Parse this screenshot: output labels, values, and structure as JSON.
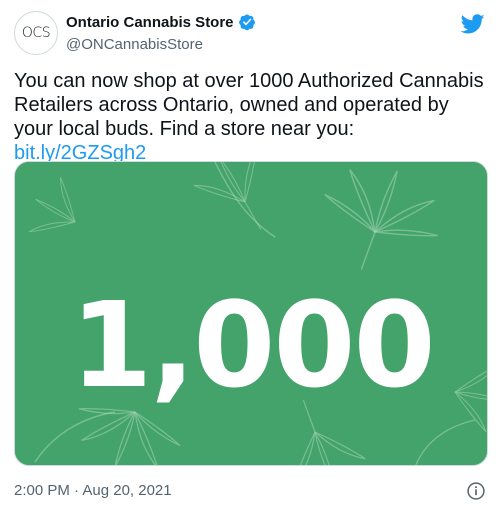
{
  "author": {
    "avatar_text": "OCS",
    "display_name": "Ontario Cannabis Store",
    "handle": "@ONCannabisStore",
    "verified": true
  },
  "tweet": {
    "text": "You can now shop at over 1000 Authorized Cannabis Retailers across Ontario, owned and operated by your local buds. Find a store near you: ",
    "link_text": "bit.ly/2GZSgh2"
  },
  "media": {
    "headline": "1,000",
    "background_color": "#44a36a"
  },
  "footer": {
    "timestamp": "2:00 PM · Aug 20, 2021"
  },
  "icons": {
    "verified": "verified-badge-icon",
    "brand": "twitter-bird-icon",
    "info": "info-icon"
  },
  "colors": {
    "accent": "#1d9bf0",
    "text": "#0f1419",
    "muted": "#536471"
  }
}
